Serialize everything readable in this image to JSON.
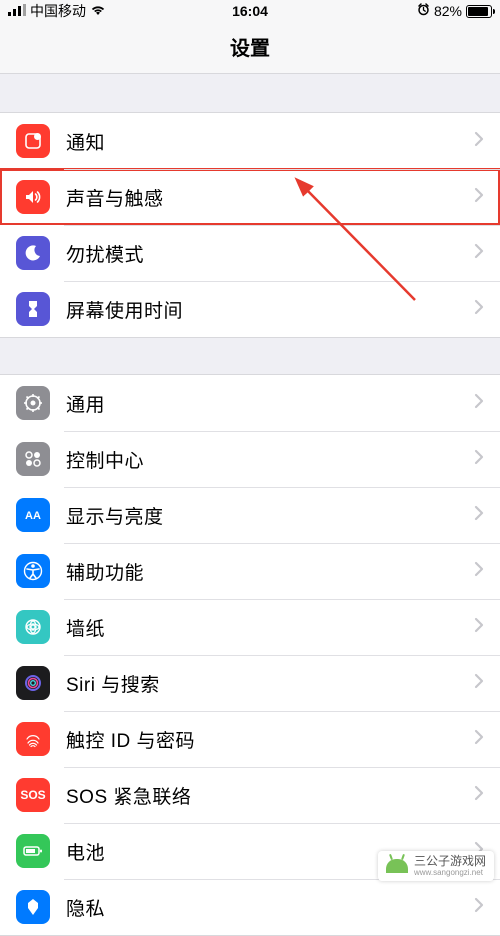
{
  "status": {
    "carrier": "中国移动",
    "time": "16:04",
    "battery_pct": "82%"
  },
  "header": {
    "title": "设置"
  },
  "groups": [
    {
      "rows": [
        {
          "key": "notifications",
          "label": "通知"
        },
        {
          "key": "sounds-haptics",
          "label": "声音与触感",
          "highlight": true
        },
        {
          "key": "do-not-disturb",
          "label": "勿扰模式"
        },
        {
          "key": "screen-time",
          "label": "屏幕使用时间"
        }
      ]
    },
    {
      "rows": [
        {
          "key": "general",
          "label": "通用"
        },
        {
          "key": "control-center",
          "label": "控制中心"
        },
        {
          "key": "display-brightness",
          "label": "显示与亮度"
        },
        {
          "key": "accessibility",
          "label": "辅助功能"
        },
        {
          "key": "wallpaper",
          "label": "墙纸"
        },
        {
          "key": "siri-search",
          "label": "Siri 与搜索"
        },
        {
          "key": "touchid-passcode",
          "label": "触控 ID 与密码"
        },
        {
          "key": "emergency-sos",
          "label": "SOS 紧急联络",
          "icon_text": "SOS"
        },
        {
          "key": "battery",
          "label": "电池"
        },
        {
          "key": "privacy",
          "label": "隐私"
        }
      ]
    }
  ],
  "watermark": {
    "brand": "三公子游戏网",
    "domain": "www.sangongzi.net"
  },
  "colors": {
    "highlight_border": "#e63a2e",
    "icon_red": "#ff3b2f",
    "icon_purple": "#5856d6",
    "icon_gray": "#8e8e93",
    "icon_blue": "#007aff",
    "icon_teal": "#34c7c2",
    "icon_green": "#34c759",
    "icon_orange": "#ff9500"
  }
}
